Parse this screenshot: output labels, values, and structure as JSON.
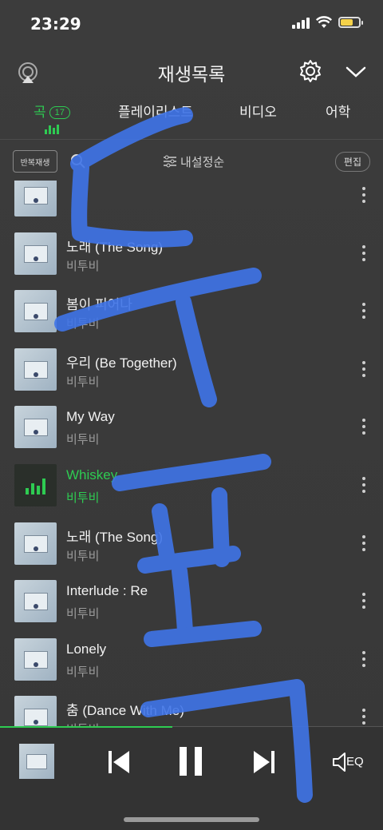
{
  "status": {
    "time": "23:29"
  },
  "header": {
    "title": "재생목록"
  },
  "tabs": [
    {
      "label": "곡",
      "count": "17"
    },
    {
      "label": "플레이리스트"
    },
    {
      "label": "비디오"
    },
    {
      "label": "어학"
    }
  ],
  "toolbar": {
    "repeat_label": "반복재생",
    "sort_label": "내설정순",
    "edit_label": "편집"
  },
  "songs": [
    {
      "title": "",
      "artist": ""
    },
    {
      "title": "노래 (The Song)",
      "artist": "비투비"
    },
    {
      "title": "봄이 피어나",
      "artist": "비투비"
    },
    {
      "title": "우리 (Be Together)",
      "artist": "비투비"
    },
    {
      "title": "My Way",
      "artist": "비투비"
    },
    {
      "title": "Whiskey",
      "artist": "비투비",
      "playing": true
    },
    {
      "title": "노래 (The Song)",
      "artist": "비투비"
    },
    {
      "title": "Interlude : Re",
      "artist": "비투비"
    },
    {
      "title": "Lonely",
      "artist": "비투비"
    },
    {
      "title": "춤 (Dance With Me)",
      "artist": "비투비"
    }
  ],
  "player": {
    "eq_label": "EQ",
    "progress": 0.45
  },
  "colors": {
    "accent": "#2ecc52",
    "scribble": "#3f74e8"
  }
}
